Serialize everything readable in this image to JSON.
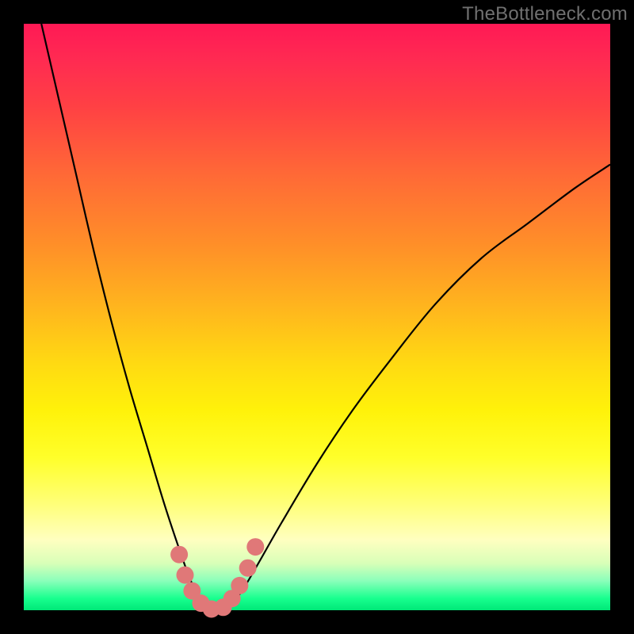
{
  "watermark": "TheBottleneck.com",
  "chart_data": {
    "type": "line",
    "title": "",
    "xlabel": "",
    "ylabel": "",
    "xlim": [
      0,
      1
    ],
    "ylim": [
      0,
      1
    ],
    "series": [
      {
        "name": "bottleneck-curve",
        "color": "#000000",
        "x": [
          0.03,
          0.06,
          0.09,
          0.12,
          0.15,
          0.18,
          0.21,
          0.24,
          0.27,
          0.285,
          0.3,
          0.315,
          0.33,
          0.35,
          0.37,
          0.4,
          0.44,
          0.5,
          0.56,
          0.62,
          0.7,
          0.78,
          0.86,
          0.94,
          1.0
        ],
        "y": [
          1.0,
          0.87,
          0.74,
          0.61,
          0.49,
          0.38,
          0.28,
          0.18,
          0.09,
          0.05,
          0.02,
          0.0,
          0.0,
          0.01,
          0.03,
          0.08,
          0.15,
          0.25,
          0.34,
          0.42,
          0.52,
          0.6,
          0.66,
          0.72,
          0.76
        ]
      },
      {
        "name": "highlight-dots",
        "color": "#e07878",
        "x": [
          0.265,
          0.275,
          0.287,
          0.302,
          0.32,
          0.34,
          0.355,
          0.368,
          0.382,
          0.395
        ],
        "y": [
          0.095,
          0.06,
          0.033,
          0.012,
          0.002,
          0.005,
          0.02,
          0.042,
          0.072,
          0.108
        ]
      }
    ],
    "gradient_stops": [
      {
        "pos": 0.0,
        "color": "#ff1955"
      },
      {
        "pos": 0.5,
        "color": "#ffc818"
      },
      {
        "pos": 0.8,
        "color": "#ffff60"
      },
      {
        "pos": 1.0,
        "color": "#00e878"
      }
    ]
  }
}
